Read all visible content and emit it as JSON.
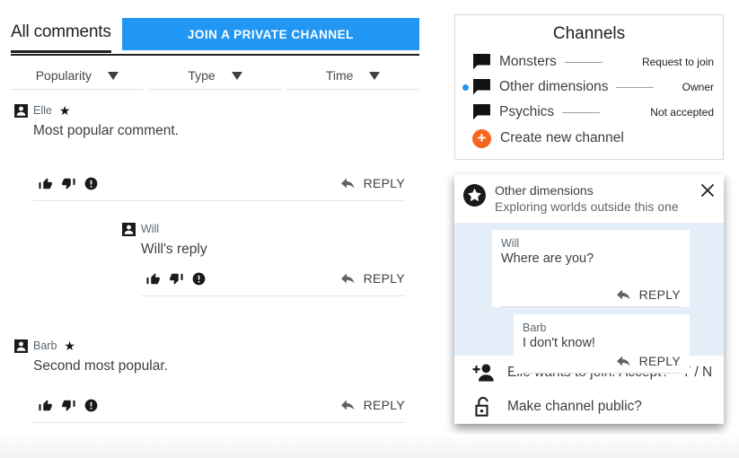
{
  "comments_panel": {
    "tab_label": "All comments",
    "join_button_label": "JOIN A PRIVATE CHANNEL",
    "sort_controls": [
      {
        "label": "Popularity",
        "icon": "chevron-down-icon"
      },
      {
        "label": "Type",
        "icon": "chevron-down-icon"
      },
      {
        "label": "Time",
        "icon": "chevron-down-icon"
      }
    ],
    "reply_label": "REPLY",
    "comments": [
      {
        "author": "Elle",
        "starred": true,
        "text": "Most popular comment.",
        "reply_label": "REPLY",
        "replies": [
          {
            "author": "Will",
            "starred": false,
            "text": "Will's reply",
            "reply_label": "REPLY"
          }
        ]
      },
      {
        "author": "Barb",
        "starred": true,
        "text": "Second most popular.",
        "reply_label": "REPLY",
        "replies": []
      }
    ]
  },
  "channels_card": {
    "title": "Channels",
    "items": [
      {
        "name": "Monsters",
        "status": "Request to join",
        "selected": false
      },
      {
        "name": "Other dimensions",
        "status": "Owner",
        "selected": true
      },
      {
        "name": "Psychics",
        "status": "Not accepted",
        "selected": false
      }
    ],
    "create_label": "Create new channel"
  },
  "chat_panel": {
    "title": "Other dimensions",
    "subtitle": "Exploring worlds outside this one",
    "close_icon": "close-icon",
    "messages": [
      {
        "author": "Will",
        "text": "Where are you?",
        "reply_label": "REPLY",
        "align": "from-will"
      },
      {
        "author": "Barb",
        "text": "I don't know!",
        "reply_label": "REPLY",
        "align": "from-barb"
      }
    ],
    "actions": [
      {
        "icon": "person-add-icon",
        "label": "Elle wants to join. Accept?",
        "choice": "Y / N"
      },
      {
        "icon": "unlock-icon",
        "label": "Make channel public?",
        "choice": ""
      }
    ]
  },
  "colors": {
    "accent_blue": "#2196f3",
    "message_bg": "#e3eef9",
    "create_orange": "#f4661e",
    "text_primary": "#3c4043",
    "text_muted": "#5b6770"
  }
}
